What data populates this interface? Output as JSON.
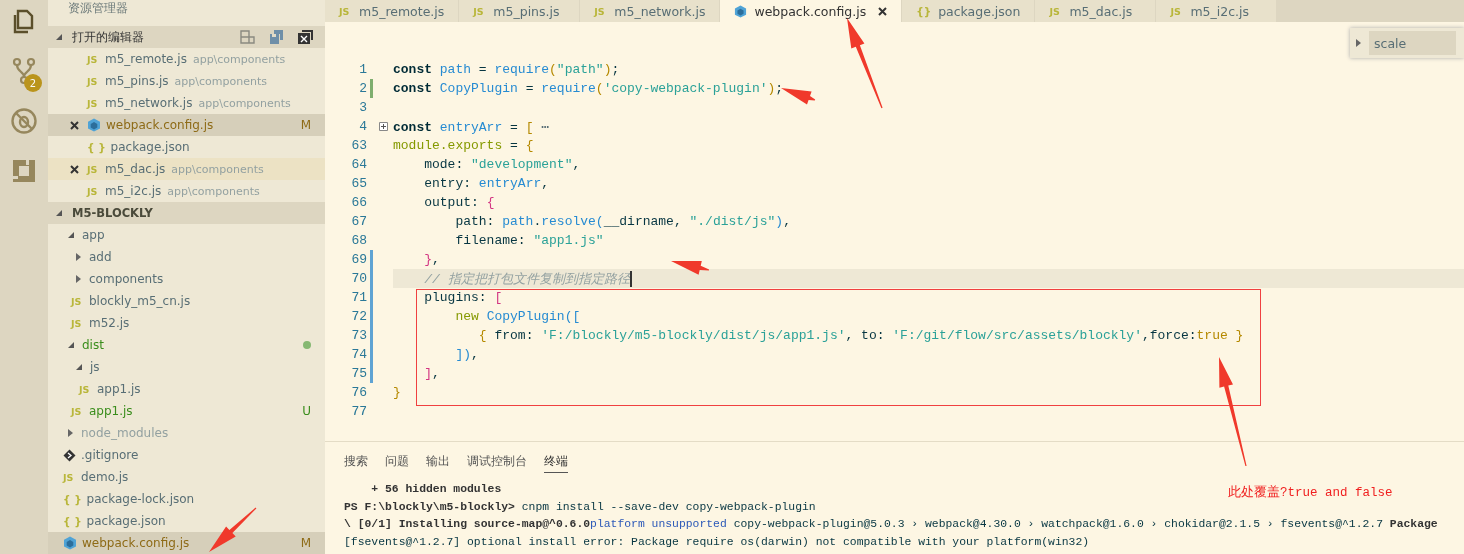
{
  "activity_bar": {
    "items": [
      {
        "kind": "files",
        "selected": true
      },
      {
        "kind": "scm",
        "selected": false,
        "badge": "2"
      },
      {
        "kind": "debug",
        "selected": false
      },
      {
        "kind": "extensions",
        "selected": false
      }
    ]
  },
  "sidebar": {
    "title": "资源管理器",
    "open_editors": {
      "title": "打开的编辑器",
      "expanded": true,
      "items": [
        {
          "name": "m5_remote.js",
          "kind": "js",
          "glyph": "JS",
          "description": "app\\components",
          "show_close": false,
          "selected": false,
          "hovered": false,
          "color": "#586e75"
        },
        {
          "name": "m5_pins.js",
          "kind": "js",
          "glyph": "JS",
          "description": "app\\components",
          "show_close": false,
          "selected": false,
          "hovered": false,
          "color": "#586e75"
        },
        {
          "name": "m5_network.js",
          "kind": "js",
          "glyph": "JS",
          "description": "app\\components",
          "show_close": false,
          "selected": false,
          "hovered": false,
          "color": "#586e75"
        },
        {
          "name": "webpack.config.js",
          "kind": "webpack",
          "show_close": true,
          "selected": true,
          "hovered": false,
          "color": "#8e6b17",
          "badge": "M"
        },
        {
          "name": "package.json",
          "kind": "json",
          "glyph": "{ }",
          "show_close": false,
          "selected": false,
          "hovered": false,
          "color": "#586e75"
        },
        {
          "name": "m5_dac.js",
          "kind": "js",
          "glyph": "JS",
          "description": "app\\components",
          "show_close": true,
          "selected": false,
          "hovered": true,
          "color": "#586e75"
        },
        {
          "name": "m5_i2c.js",
          "kind": "js",
          "glyph": "JS",
          "description": "app\\components",
          "show_close": false,
          "selected": false,
          "hovered": false,
          "color": "#586e75"
        }
      ]
    },
    "project": {
      "title": "M5-BLOCKLY",
      "expanded": true,
      "items": [
        {
          "name": "app",
          "kind": "folder",
          "expanded": true,
          "color": "#586e75",
          "dot": false,
          "selected": false,
          "children": [
            {
              "name": "add",
              "kind": "folder",
              "expanded": false,
              "color": "#586e75",
              "dot": false,
              "selected": false
            },
            {
              "name": "components",
              "kind": "folder",
              "expanded": false,
              "color": "#586e75",
              "dot": false,
              "selected": false
            },
            {
              "name": "blockly_m5_cn.js",
              "kind": "js",
              "glyph": "JS",
              "color": "#586e75",
              "dot": false,
              "selected": false
            },
            {
              "name": "m52.js",
              "kind": "js",
              "glyph": "JS",
              "color": "#586e75",
              "dot": false,
              "selected": false
            }
          ]
        },
        {
          "name": "dist",
          "kind": "folder",
          "expanded": true,
          "color": "#3a8d1c",
          "dot": true,
          "selected": false,
          "children": [
            {
              "name": "js",
              "kind": "folder",
              "expanded": true,
              "color": "#586e75",
              "dot": false,
              "selected": false,
              "children": [
                {
                  "name": "app1.js",
                  "kind": "js",
                  "glyph": "JS",
                  "color": "#586e75",
                  "dot": false,
                  "selected": false
                }
              ]
            },
            {
              "name": "app1.js",
              "kind": "js",
              "glyph": "JS",
              "color": "#3a8d1c",
              "badge": "U",
              "dot": false,
              "selected": false
            }
          ]
        },
        {
          "name": "node_modules",
          "kind": "folder",
          "expanded": false,
          "color": "#93a1a1",
          "dot": false,
          "selected": false
        },
        {
          "name": ".gitignore",
          "kind": "git",
          "color": "#586e75",
          "dot": false,
          "selected": false
        },
        {
          "name": "demo.js",
          "kind": "js",
          "glyph": "JS",
          "color": "#586e75",
          "dot": false,
          "selected": false
        },
        {
          "name": "package-lock.json",
          "kind": "json",
          "glyph": "{ }",
          "color": "#586e75",
          "dot": false,
          "selected": false
        },
        {
          "name": "package.json",
          "kind": "json",
          "glyph": "{ }",
          "color": "#586e75",
          "dot": false,
          "selected": false
        },
        {
          "name": "webpack.config.js",
          "kind": "webpack",
          "color": "#8e6b17",
          "badge": "M",
          "dot": false,
          "selected": true
        }
      ]
    }
  },
  "tabs": [
    {
      "label": "m5_remote.js",
      "kind": "js",
      "glyph": "JS",
      "selected": false
    },
    {
      "label": "m5_pins.js",
      "kind": "js",
      "glyph": "JS",
      "selected": false
    },
    {
      "label": "m5_network.js",
      "kind": "js",
      "glyph": "JS",
      "selected": false
    },
    {
      "label": "webpack.config.js",
      "kind": "webpack",
      "selected": true
    },
    {
      "label": "package.json",
      "kind": "json",
      "glyph": "{}",
      "selected": false
    },
    {
      "label": "m5_dac.js",
      "kind": "js",
      "glyph": "JS",
      "selected": false
    },
    {
      "label": "m5_i2c.js",
      "kind": "js",
      "glyph": "JS",
      "selected": false
    }
  ],
  "find_widget": {
    "expanded": false,
    "value": "scale"
  },
  "code": [
    {
      "number": "1",
      "collapsed": false,
      "added": false,
      "modified": false,
      "current": false,
      "tokens": [
        {
          "kind": "kw",
          "t": "const "
        },
        {
          "kind": "var",
          "t": "path"
        },
        {
          "kind": "plain",
          "t": " = "
        },
        {
          "kind": "fn",
          "t": "require"
        },
        {
          "kind": "b1",
          "t": "("
        },
        {
          "kind": "str",
          "t": "\"path\""
        },
        {
          "kind": "b1",
          "t": ")"
        },
        {
          "kind": "plain",
          "t": ";"
        }
      ]
    },
    {
      "number": "2",
      "collapsed": false,
      "added": true,
      "modified": false,
      "current": false,
      "tokens": [
        {
          "kind": "kw",
          "t": "const "
        },
        {
          "kind": "var",
          "t": "CopyPlugin"
        },
        {
          "kind": "plain",
          "t": " = "
        },
        {
          "kind": "fn",
          "t": "require"
        },
        {
          "kind": "b1",
          "t": "("
        },
        {
          "kind": "str",
          "t": "'copy-webpack-plugin'"
        },
        {
          "kind": "b1",
          "t": ")"
        },
        {
          "kind": "plain",
          "t": ";"
        }
      ]
    },
    {
      "number": "3",
      "collapsed": false,
      "added": false,
      "modified": false,
      "current": false
    },
    {
      "number": "4",
      "collapsed": true,
      "added": false,
      "modified": false,
      "current": false,
      "tokens": [
        {
          "kind": "kw",
          "t": "const "
        },
        {
          "kind": "var",
          "t": "entryArr"
        },
        {
          "kind": "plain",
          "t": " = "
        },
        {
          "kind": "b1",
          "t": "["
        },
        {
          "kind": "ellipsis",
          "t": " ⋯"
        }
      ]
    },
    {
      "number": "63",
      "collapsed": false,
      "added": false,
      "modified": false,
      "current": false,
      "tokens": [
        {
          "kind": "mod",
          "t": "module.exports"
        },
        {
          "kind": "plain",
          "t": " = "
        },
        {
          "kind": "b1",
          "t": "{"
        }
      ]
    },
    {
      "number": "64",
      "collapsed": false,
      "added": false,
      "modified": false,
      "current": false,
      "tokens": [
        {
          "kind": "plain",
          "t": "    mode: "
        },
        {
          "kind": "str",
          "t": "\"development\""
        },
        {
          "kind": "plain",
          "t": ","
        }
      ]
    },
    {
      "number": "65",
      "collapsed": false,
      "added": false,
      "modified": false,
      "current": false,
      "tokens": [
        {
          "kind": "plain",
          "t": "    entry: "
        },
        {
          "kind": "var",
          "t": "entryArr"
        },
        {
          "kind": "plain",
          "t": ","
        }
      ]
    },
    {
      "number": "66",
      "collapsed": false,
      "added": false,
      "modified": false,
      "current": false,
      "tokens": [
        {
          "kind": "plain",
          "t": "    output: "
        },
        {
          "kind": "b2",
          "t": "{"
        }
      ]
    },
    {
      "number": "67",
      "collapsed": false,
      "added": false,
      "modified": false,
      "current": false,
      "tokens": [
        {
          "kind": "plain",
          "t": "        path: "
        },
        {
          "kind": "var",
          "t": "path"
        },
        {
          "kind": "plain",
          "t": "."
        },
        {
          "kind": "fn",
          "t": "resolve"
        },
        {
          "kind": "b3",
          "t": "("
        },
        {
          "kind": "plain",
          "t": "__dirname, "
        },
        {
          "kind": "str",
          "t": "\"./dist/js\""
        },
        {
          "kind": "b3",
          "t": ")"
        },
        {
          "kind": "plain",
          "t": ","
        }
      ]
    },
    {
      "number": "68",
      "collapsed": false,
      "added": false,
      "modified": false,
      "current": false,
      "tokens": [
        {
          "kind": "plain",
          "t": "        filename: "
        },
        {
          "kind": "str",
          "t": "\"app1.js\""
        }
      ]
    },
    {
      "number": "69",
      "collapsed": false,
      "added": false,
      "modified": true,
      "current": false,
      "tokens": [
        {
          "kind": "b2",
          "t": "    }"
        },
        {
          "kind": "plain",
          "t": ","
        }
      ]
    },
    {
      "number": "70",
      "collapsed": false,
      "added": false,
      "modified": true,
      "current": true,
      "tokens": [
        {
          "kind": "comment",
          "t": "    // 指定把打包文件复制到指定路径"
        }
      ]
    },
    {
      "number": "71",
      "collapsed": false,
      "added": false,
      "modified": true,
      "current": false,
      "tokens": [
        {
          "kind": "plain",
          "t": "    plugins: "
        },
        {
          "kind": "b2",
          "t": "["
        }
      ]
    },
    {
      "number": "72",
      "collapsed": false,
      "added": false,
      "modified": true,
      "current": false,
      "tokens": [
        {
          "kind": "new",
          "t": "        new "
        },
        {
          "kind": "var",
          "t": "CopyPlugin"
        },
        {
          "kind": "b3",
          "t": "(["
        }
      ]
    },
    {
      "number": "73",
      "collapsed": false,
      "added": false,
      "modified": true,
      "current": false,
      "tokens": [
        {
          "kind": "b1",
          "t": "           {"
        },
        {
          "kind": "plain",
          "t": " from: "
        },
        {
          "kind": "str",
          "t": "'F:/blockly/m5-blockly/dist/js/app1.js'"
        },
        {
          "kind": "plain",
          "t": ", to: "
        },
        {
          "kind": "str",
          "t": "'F:/git/flow/src/assets/blockly'"
        },
        {
          "kind": "plain",
          "t": ",force:"
        },
        {
          "kind": "bool",
          "t": "true"
        },
        {
          "kind": "b1",
          "t": " }"
        }
      ]
    },
    {
      "number": "74",
      "collapsed": false,
      "added": false,
      "modified": true,
      "current": false,
      "tokens": [
        {
          "kind": "b3",
          "t": "        ])"
        },
        {
          "kind": "plain",
          "t": ","
        }
      ]
    },
    {
      "number": "75",
      "collapsed": false,
      "added": false,
      "modified": true,
      "current": false,
      "tokens": [
        {
          "kind": "b2",
          "t": "    ]"
        },
        {
          "kind": "plain",
          "t": ","
        }
      ]
    },
    {
      "number": "76",
      "collapsed": false,
      "added": false,
      "modified": false,
      "current": false,
      "tokens": [
        {
          "kind": "b1",
          "t": "}"
        }
      ]
    },
    {
      "number": "77",
      "collapsed": false,
      "added": false,
      "modified": false,
      "current": false
    }
  ],
  "panel": {
    "tabs": [
      {
        "label": "搜索",
        "selected": false
      },
      {
        "label": "问题",
        "selected": false
      },
      {
        "label": "输出",
        "selected": false
      },
      {
        "label": "调试控制台",
        "selected": false
      },
      {
        "label": "终端",
        "selected": true
      }
    ],
    "terminal": [
      [
        {
          "kind": "bold",
          "t": "    + 56 hidden modules"
        }
      ],
      [
        {
          "kind": "bold",
          "t": "PS F:\\blockly\\m5-blockly> "
        },
        {
          "kind": "plain",
          "t": "cnpm install --save-dev copy-webpack-plugin"
        }
      ],
      [
        {
          "kind": "bold",
          "t": "\\ [0/1] Installing source-map@^0.6.0"
        },
        {
          "kind": "info",
          "t": "platform unsupported"
        },
        {
          "kind": "plain",
          "t": " copy-webpack-plugin@5.0.3 › webpack@4.30.0 › watchpack@1.6.0 › chokidar@2.1.5 › fsevents@^1.2.7 "
        },
        {
          "kind": "bold",
          "t": "Package"
        }
      ],
      [
        {
          "kind": "plain",
          "t": "[fsevents@^1.2.7] optional install error: Package require os(darwin) not compatible with your platform(win32)"
        }
      ]
    ]
  },
  "annotation": {
    "note": "此处覆盖?true and false"
  }
}
